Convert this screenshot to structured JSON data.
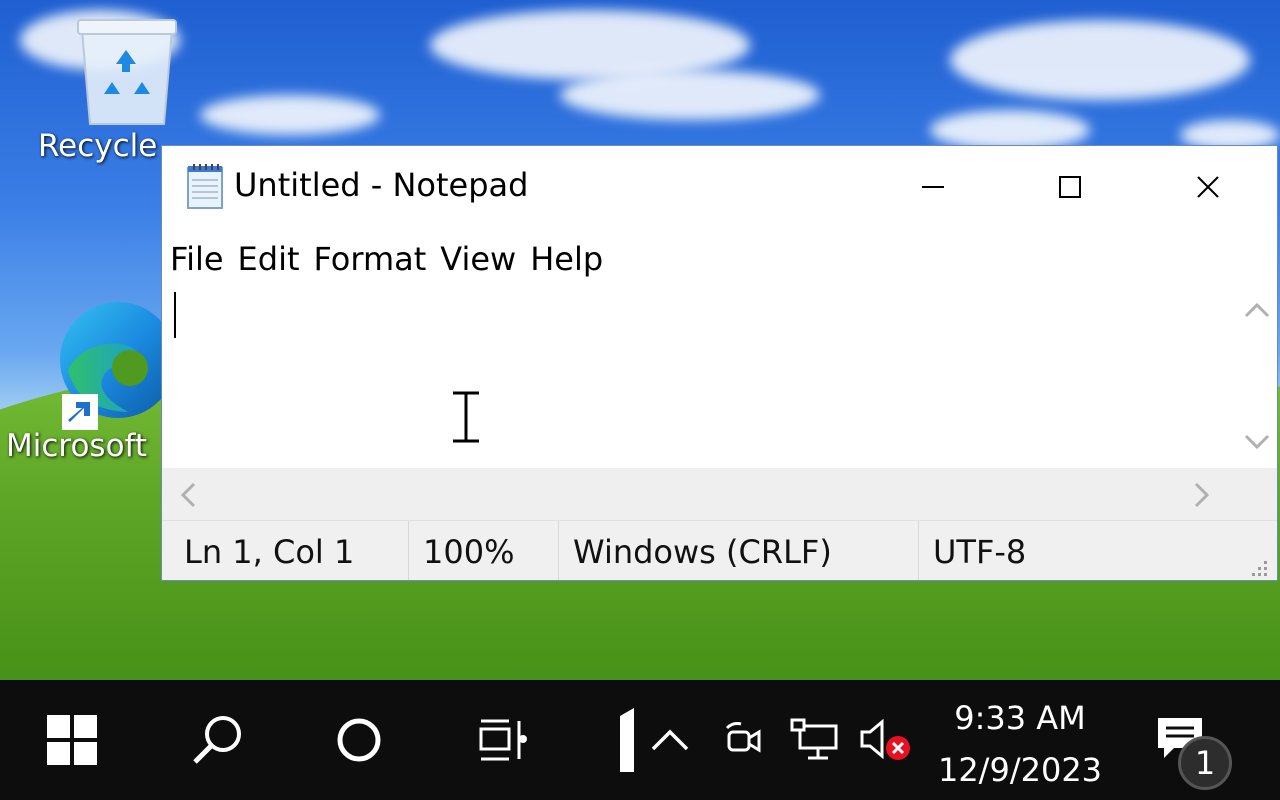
{
  "desktop": {
    "icons": [
      {
        "label": "Recycle"
      },
      {
        "label": "Microsoft"
      }
    ]
  },
  "notepad": {
    "title": "Untitled - Notepad",
    "menu": [
      "File",
      "Edit",
      "Format",
      "View",
      "Help"
    ],
    "content": "",
    "status": {
      "position": "Ln 1, Col 1",
      "zoom": "100%",
      "line_ending": "Windows (CRLF)",
      "encoding": "UTF-8"
    }
  },
  "taskbar": {
    "time": "9:33 AM",
    "date": "12/9/2023",
    "notification_count": "1",
    "icons": [
      "windows-start-icon",
      "search-icon",
      "cortana-icon",
      "task-view-icon",
      "taskbar-app-icon",
      "show-hidden-icons-chevron",
      "meet-now-icon",
      "network-icon",
      "volume-muted-icon",
      "action-center-icon"
    ]
  }
}
